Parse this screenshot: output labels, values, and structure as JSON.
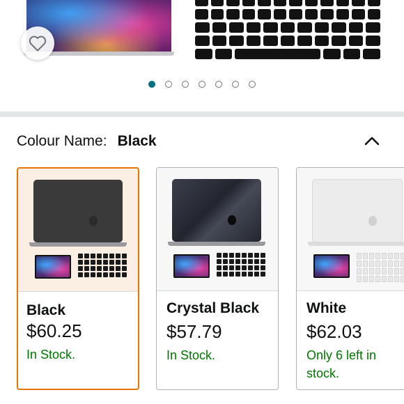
{
  "carousel": {
    "total_images": 7,
    "active_index": 0
  },
  "variation": {
    "label": "Colour Name:",
    "selected_value": "Black",
    "expanded": true
  },
  "options": [
    {
      "name": "Black",
      "price": "$60.25",
      "stock": "In Stock.",
      "selected": true,
      "case_color": "#3a3a3a",
      "key_color": "#1a1a1a"
    },
    {
      "name": "Crystal Black",
      "price": "$57.79",
      "stock": "In Stock.",
      "selected": false,
      "case_color": "#2b2e38",
      "key_color": "#1a1a1a"
    },
    {
      "name": "White",
      "price": "$62.03",
      "stock": "Only 6 left in stock.",
      "selected": false,
      "case_color": "#ececec",
      "key_color": "#e8e8e8"
    }
  ],
  "icons": {
    "favorite": "heart-outline-icon",
    "collapse": "chevron-up-icon"
  },
  "colors": {
    "accent_teal": "#007185",
    "selected_border": "#e77600",
    "stock_green": "#007600"
  }
}
